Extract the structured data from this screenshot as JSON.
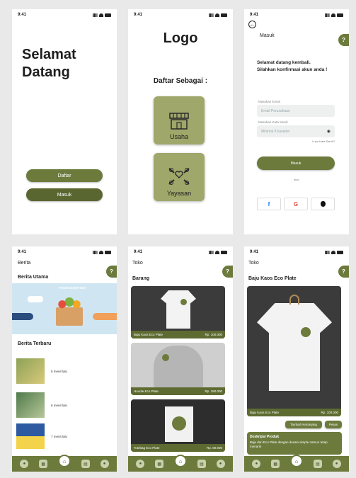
{
  "status_time": "9:41",
  "colors": {
    "olive": "#6c7a3c",
    "olive_light": "#9fa76a",
    "bg": "#e9e9e9"
  },
  "welcome": {
    "title_line1": "Selamat",
    "title_line2": "Datang",
    "register": "Daftar",
    "login": "Masuk"
  },
  "register_as": {
    "logo": "Logo",
    "heading": "Daftar Sebagai :",
    "option1": "Usaha",
    "option2": "Yayasan"
  },
  "login": {
    "title": "Masuk",
    "welcome_line1": "Selamat datang kembali.",
    "welcome_line2": "Silahkan konfirmasi akun anda !",
    "email_label": "Masukan Email",
    "email_placeholder": "Email Perusahaan",
    "password_label": "Masukan Kata Sandi",
    "password_placeholder": "Minimal 8 karakter",
    "forgot": "Lupa Kata Sandi?",
    "submit": "Masuk",
    "or": "atau",
    "facebook": "f",
    "google": "G",
    "apple": ""
  },
  "news": {
    "title": "Berita",
    "main_heading": "Berita Utama",
    "banner_caption": "FOOD DONATION",
    "latest_heading": "Berita Terbaru",
    "items": [
      {
        "time": "5 menit lalu"
      },
      {
        "time": "6 menit lalu"
      },
      {
        "time": "7 menit lalu"
      }
    ]
  },
  "shop": {
    "title": "Toko",
    "section": "Barang",
    "products": [
      {
        "name": "Baju Kaos Eco Plate",
        "price": "Rp. 100.000"
      },
      {
        "name": "Hoodie Eco Plate",
        "price": "Rp. 280.000"
      },
      {
        "name": "Totebag Eco Plate",
        "price": "Rp. 80.000"
      }
    ]
  },
  "detail": {
    "title": "Toko",
    "product_title": "Baju Kaos Eco Plate",
    "name": "Baju Kaos Eco Plate",
    "price": "Rp. 100.000",
    "add_cart": "Tambah Keranjang",
    "order": "Pesan",
    "desc_title": "Deskripsi Produk",
    "desc_text": "Baju dari Eco Plate dengan desain simple namun tetap menarik"
  },
  "help": "?",
  "nav": {
    "home_icon": "⌂"
  }
}
